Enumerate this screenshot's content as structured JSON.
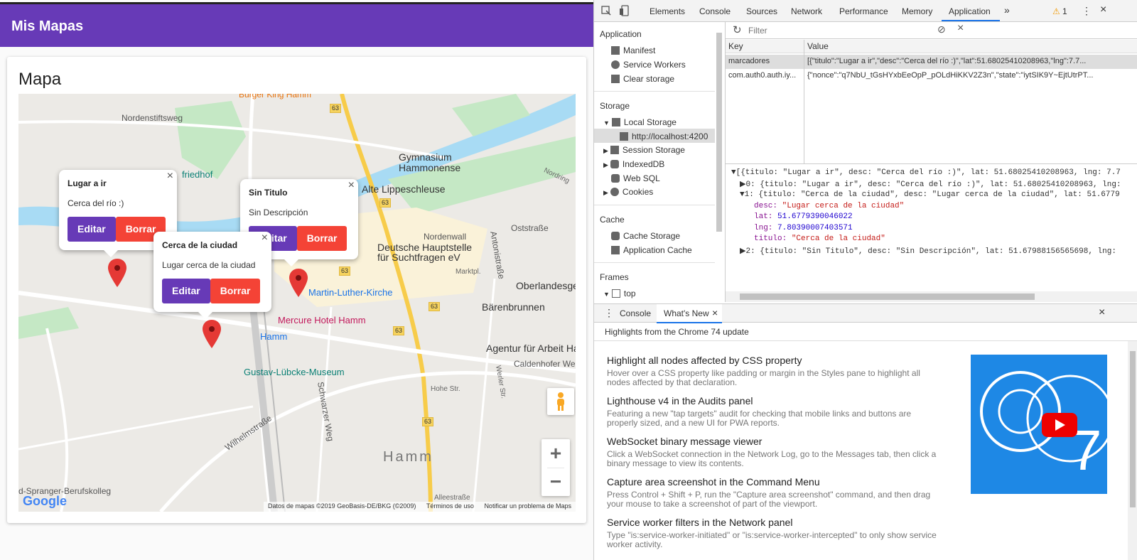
{
  "app": {
    "title": "Mis Mapas",
    "card_title": "Mapa"
  },
  "map": {
    "labels": {
      "nordenstiftsweg": "Nordenstiftsweg",
      "gymnasium": "Gymnasium Hammonense",
      "friedhof": "friedhof",
      "lippe": "Alte Lippeschleuse",
      "hauptstelle": "Deutsche Hauptstelle für Suchtfragen eV",
      "nordenwall": "Nordenwall",
      "oststrasse": "Oststraße",
      "antonistrasse": "Antonistraße",
      "oberlandesger": "Oberlandesger",
      "martin": "Martin-Luther-Kirche",
      "barenbrunnen": "Bärenbrunnen",
      "mercure": "Mercure Hotel Hamm",
      "hamm_station": "Hamm",
      "agentur": "Agentur für Arbeit Ham",
      "caldenhofer": "Caldenhofer Weg",
      "gustav": "Gustav-Lübcke-Museum",
      "schwarzer": "Schwarzer Weg",
      "hamm_big": "Hamm",
      "sprenger": "d-Spranger-Berufskolleg",
      "wilhelmstrasse": "Wilhelmstraße",
      "burger": "Burger King Hamm",
      "nordring": "Nordring",
      "marktpl": "Marktpl.",
      "hohe": "Hohe Str.",
      "werler": "Werler Str.",
      "allee": "Alleestraße"
    },
    "road_shields": [
      "63",
      "63",
      "63",
      "63",
      "63",
      "63"
    ],
    "attribution": "Datos de mapas ©2019 GeoBasis-DE/BKG (©2009)",
    "terms": "Términos de uso",
    "report": "Notificar un problema de Maps",
    "google_logo": "Google",
    "zoom_in": "+",
    "zoom_out": "−"
  },
  "markers": [
    {
      "titulo": "Lugar a ir",
      "desc": "Cerca del río :)",
      "edit_label": "Editar",
      "delete_label": "Borrar"
    },
    {
      "titulo": "Sin Titulo",
      "desc": "Sin Descripción",
      "edit_label": "Editar",
      "delete_label": "Borrar"
    },
    {
      "titulo": "Cerca de la ciudad",
      "desc": "Lugar cerca de la ciudad",
      "edit_label": "Editar",
      "delete_label": "Borrar"
    }
  ],
  "devtools": {
    "tabs": [
      "Elements",
      "Console",
      "Sources",
      "Network",
      "Performance",
      "Memory",
      "Application"
    ],
    "active_tab": "Application",
    "warning_count": "1",
    "sidebar": {
      "application_header": "Application",
      "manifest": "Manifest",
      "service_workers": "Service Workers",
      "clear_storage": "Clear storage",
      "storage_header": "Storage",
      "local_storage": "Local Storage",
      "localhost": "http://localhost:4200",
      "session_storage": "Session Storage",
      "indexeddb": "IndexedDB",
      "websql": "Web SQL",
      "cookies": "Cookies",
      "cache_header": "Cache",
      "cache_storage": "Cache Storage",
      "app_cache": "Application Cache",
      "frames_header": "Frames",
      "top": "top"
    },
    "filter_placeholder": "Filter",
    "table": {
      "key_header": "Key",
      "value_header": "Value",
      "rows": [
        {
          "key": "marcadores",
          "value": "[{\"titulo\":\"Lugar a ir\",\"desc\":\"Cerca del río :)\",\"lat\":51.68025410208963,\"lng\":7.7..."
        },
        {
          "key": "com.auth0.auth.iy...",
          "value": "{\"nonce\":\"q7NbU_tGsHYxbEeOpP_pOLdHiKKV2Z3n\",\"state\":\"iytSIK9Y~EjtUtrPT..."
        }
      ]
    },
    "preview": {
      "line0": "[{titulo: \"Lugar a ir\", desc: \"Cerca del río :)\", lat: 51.68025410208963, lng: 7.7",
      "line1": "0: {titulo: \"Lugar a ir\", desc: \"Cerca del río :)\", lat: 51.68025410208963, lng:",
      "line2": "1: {titulo: \"Cerca de la ciudad\", desc: \"Lugar cerca de la ciudad\", lat: 51.6779",
      "desc_key": "desc:",
      "desc_val": "\"Lugar cerca de la ciudad\"",
      "lat_key": "lat:",
      "lat_val": "51.6779390046022",
      "lng_key": "lng:",
      "lng_val": "7.80390007403571",
      "titulo_key": "titulo:",
      "titulo_val": "\"Cerca de la ciudad\"",
      "line7": "2: {titulo: \"Sin Titulo\", desc: \"Sin Descripción\", lat: 51.67988156565698, lng:"
    },
    "drawer": {
      "console_tab": "Console",
      "whatsnew_tab": "What's New",
      "highlights": "Highlights from the Chrome 74 update",
      "items": [
        {
          "title": "Highlight all nodes affected by CSS property",
          "desc": "Hover over a CSS property like padding or margin in the Styles pane to highlight all nodes affected by that declaration."
        },
        {
          "title": "Lighthouse v4 in the Audits panel",
          "desc": "Featuring a new \"tap targets\" audit for checking that mobile links and buttons are properly sized, and a new UI for PWA reports."
        },
        {
          "title": "WebSocket binary message viewer",
          "desc": "Click a WebSocket connection in the Network Log, go to the Messages tab, then click a binary message to view its contents."
        },
        {
          "title": "Capture area screenshot in the Command Menu",
          "desc": "Press Control + Shift + P, run the \"Capture area screenshot\" command, and then drag your mouse to take a screenshot of part of the viewport."
        },
        {
          "title": "Service worker filters in the Network panel",
          "desc": "Type \"is:service-worker-initiated\" or \"is:service-worker-intercepted\" to only show service worker activity."
        }
      ],
      "video_number": "7"
    }
  }
}
